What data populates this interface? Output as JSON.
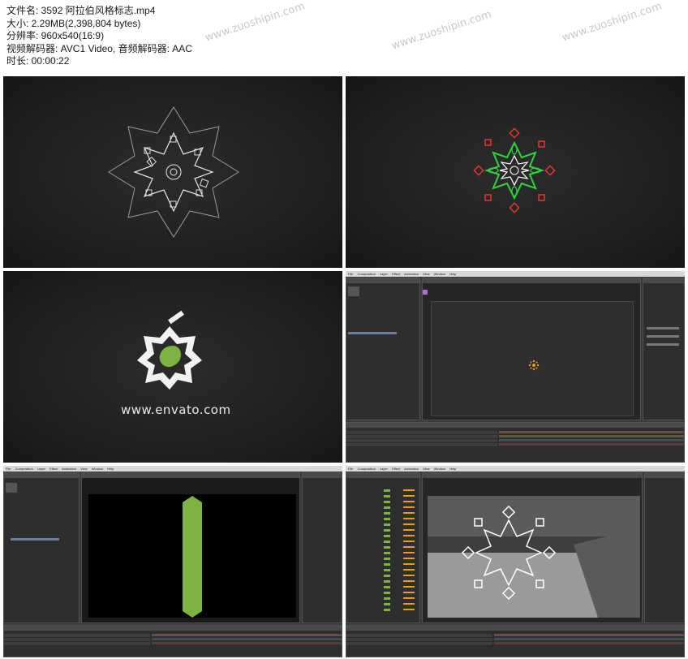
{
  "file_info": {
    "filename": "文件名: 3592 阿拉伯风格标志.mp4",
    "size": "大小: 2.29MB(2,398,804 bytes)",
    "resolution": "分辨率: 960x540(16:9)",
    "codecs": "视频解码器: AVC1 Video, 音频解码器: AAC",
    "duration": "时长: 00:00:22"
  },
  "watermark": "www.zuoshipin.com",
  "thumbnails": [
    {
      "id": "t1",
      "kind": "ornament-white"
    },
    {
      "id": "t2",
      "kind": "ornament-neon"
    },
    {
      "id": "t3",
      "kind": "logo",
      "url_text": "www.envato.com"
    },
    {
      "id": "t4",
      "kind": "after-effects",
      "menu": [
        "File",
        "Composition",
        "Layer",
        "Effect",
        "Animation",
        "View",
        "Window",
        "Help"
      ]
    },
    {
      "id": "t5",
      "kind": "after-effects",
      "menu": [
        "File",
        "Composition",
        "Layer",
        "Effect",
        "Animation",
        "View",
        "Window",
        "Help"
      ]
    },
    {
      "id": "t6",
      "kind": "after-effects",
      "menu": [
        "File",
        "Composition",
        "Layer",
        "Effect",
        "Animation",
        "View",
        "Window",
        "Help"
      ]
    }
  ],
  "colors": {
    "neon_green": "#2fd33a",
    "neon_red": "#e0382c",
    "logo_green": "#7cb342",
    "accent_orange": "#e8a100",
    "ae_purple": "#b46ad8"
  }
}
